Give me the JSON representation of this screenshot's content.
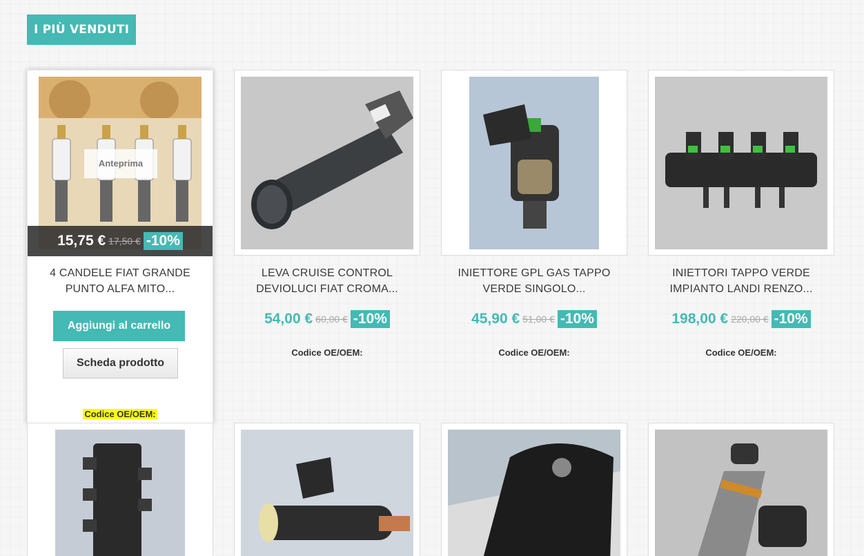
{
  "section": {
    "title": "I PIÙ VENDUTI"
  },
  "labels": {
    "quick_view": "Anteprima",
    "add_to_cart": "Aggiungi al carrello",
    "product_sheet": "Scheda prodotto",
    "oem_code": "Codice OE/OEM:"
  },
  "colors": {
    "accent": "#45b9b4",
    "highlight": "#ffff00"
  },
  "products": [
    {
      "name": "4 CANDELE FIAT GRANDE PUNTO ALFA MITO...",
      "price": "15,75 €",
      "old_price": "17,50 €",
      "discount": "-10%"
    },
    {
      "name": "LEVA CRUISE CONTROL DEVIOLUCI FIAT CROMA...",
      "price": "54,00 €",
      "old_price": "60,00 €",
      "discount": "-10%"
    },
    {
      "name": "INIETTORE GPL GAS TAPPO VERDE SINGOLO...",
      "price": "45,90 €",
      "old_price": "51,00 €",
      "discount": "-10%"
    },
    {
      "name": "INIETTORI TAPPO VERDE IMPIANTO LANDI RENZO...",
      "price": "198,00 €",
      "old_price": "220,00 €",
      "discount": "-10%"
    }
  ]
}
